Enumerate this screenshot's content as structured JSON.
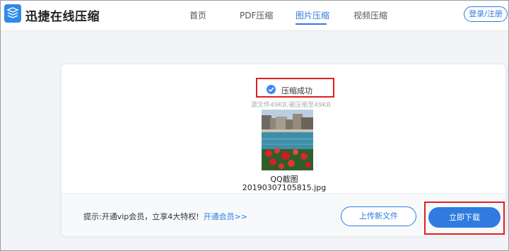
{
  "header": {
    "brand": "迅捷在线压缩",
    "nav": [
      {
        "label": "首页"
      },
      {
        "label": "PDF压缩"
      },
      {
        "label": "图片压缩"
      },
      {
        "label": "视频压缩"
      }
    ],
    "active_nav": "图片压缩",
    "login_label": "登录/注册"
  },
  "result": {
    "status": "压缩成功",
    "size_info": "源文件49KB,被压缩至49KB",
    "file_name_line1": "QQ截图",
    "file_name_line2": "20190307105815.jpg"
  },
  "footer": {
    "tip_text": "提示:开通vip会员，立享4大特权!",
    "tip_link": "开通会员>>",
    "upload_label": "上传新文件",
    "download_label": "立即下载"
  },
  "colors": {
    "accent": "#2f7be0",
    "highlight_border": "#e02020",
    "success_icon": "#3d8bf0"
  },
  "icons": {
    "logo": "layers-icon",
    "status": "check-circle-icon"
  }
}
